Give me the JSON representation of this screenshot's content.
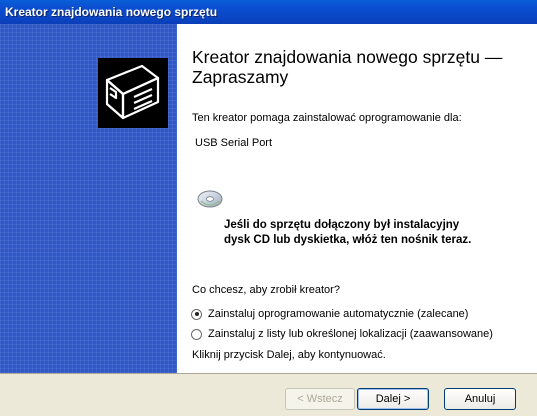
{
  "window": {
    "title": "Kreator znajdowania nowego sprzętu"
  },
  "content": {
    "heading": "Kreator znajdowania nowego sprzętu — Zapraszamy",
    "intro": "Ten kreator pomaga zainstalować oprogramowanie dla:",
    "device": "USB Serial Port",
    "cd_note_line1": "Jeśli do sprzętu dołączony był instalacyjny",
    "cd_note_line2": "dysk CD lub dyskietka, włóż ten nośnik teraz.",
    "question": "Co chcesz, aby zrobił kreator?",
    "options": [
      {
        "label": "Zainstaluj oprogramowanie automatycznie (zalecane)",
        "selected": true
      },
      {
        "label": "Zainstaluj z listy lub określonej lokalizacji (zaawansowane)",
        "selected": false
      }
    ],
    "continue_hint": "Kliknij przycisk Dalej, aby kontynuować."
  },
  "buttons": {
    "back": "< Wstecz",
    "next": "Dalej >",
    "cancel": "Anuluj"
  },
  "icons": {
    "wizard": "hardware-card-icon",
    "cd": "cd-disc-icon"
  },
  "colors": {
    "titlebar": "#0a4fd0",
    "sidebar": "#3057c6",
    "dialog_bg": "#ece9d8"
  }
}
